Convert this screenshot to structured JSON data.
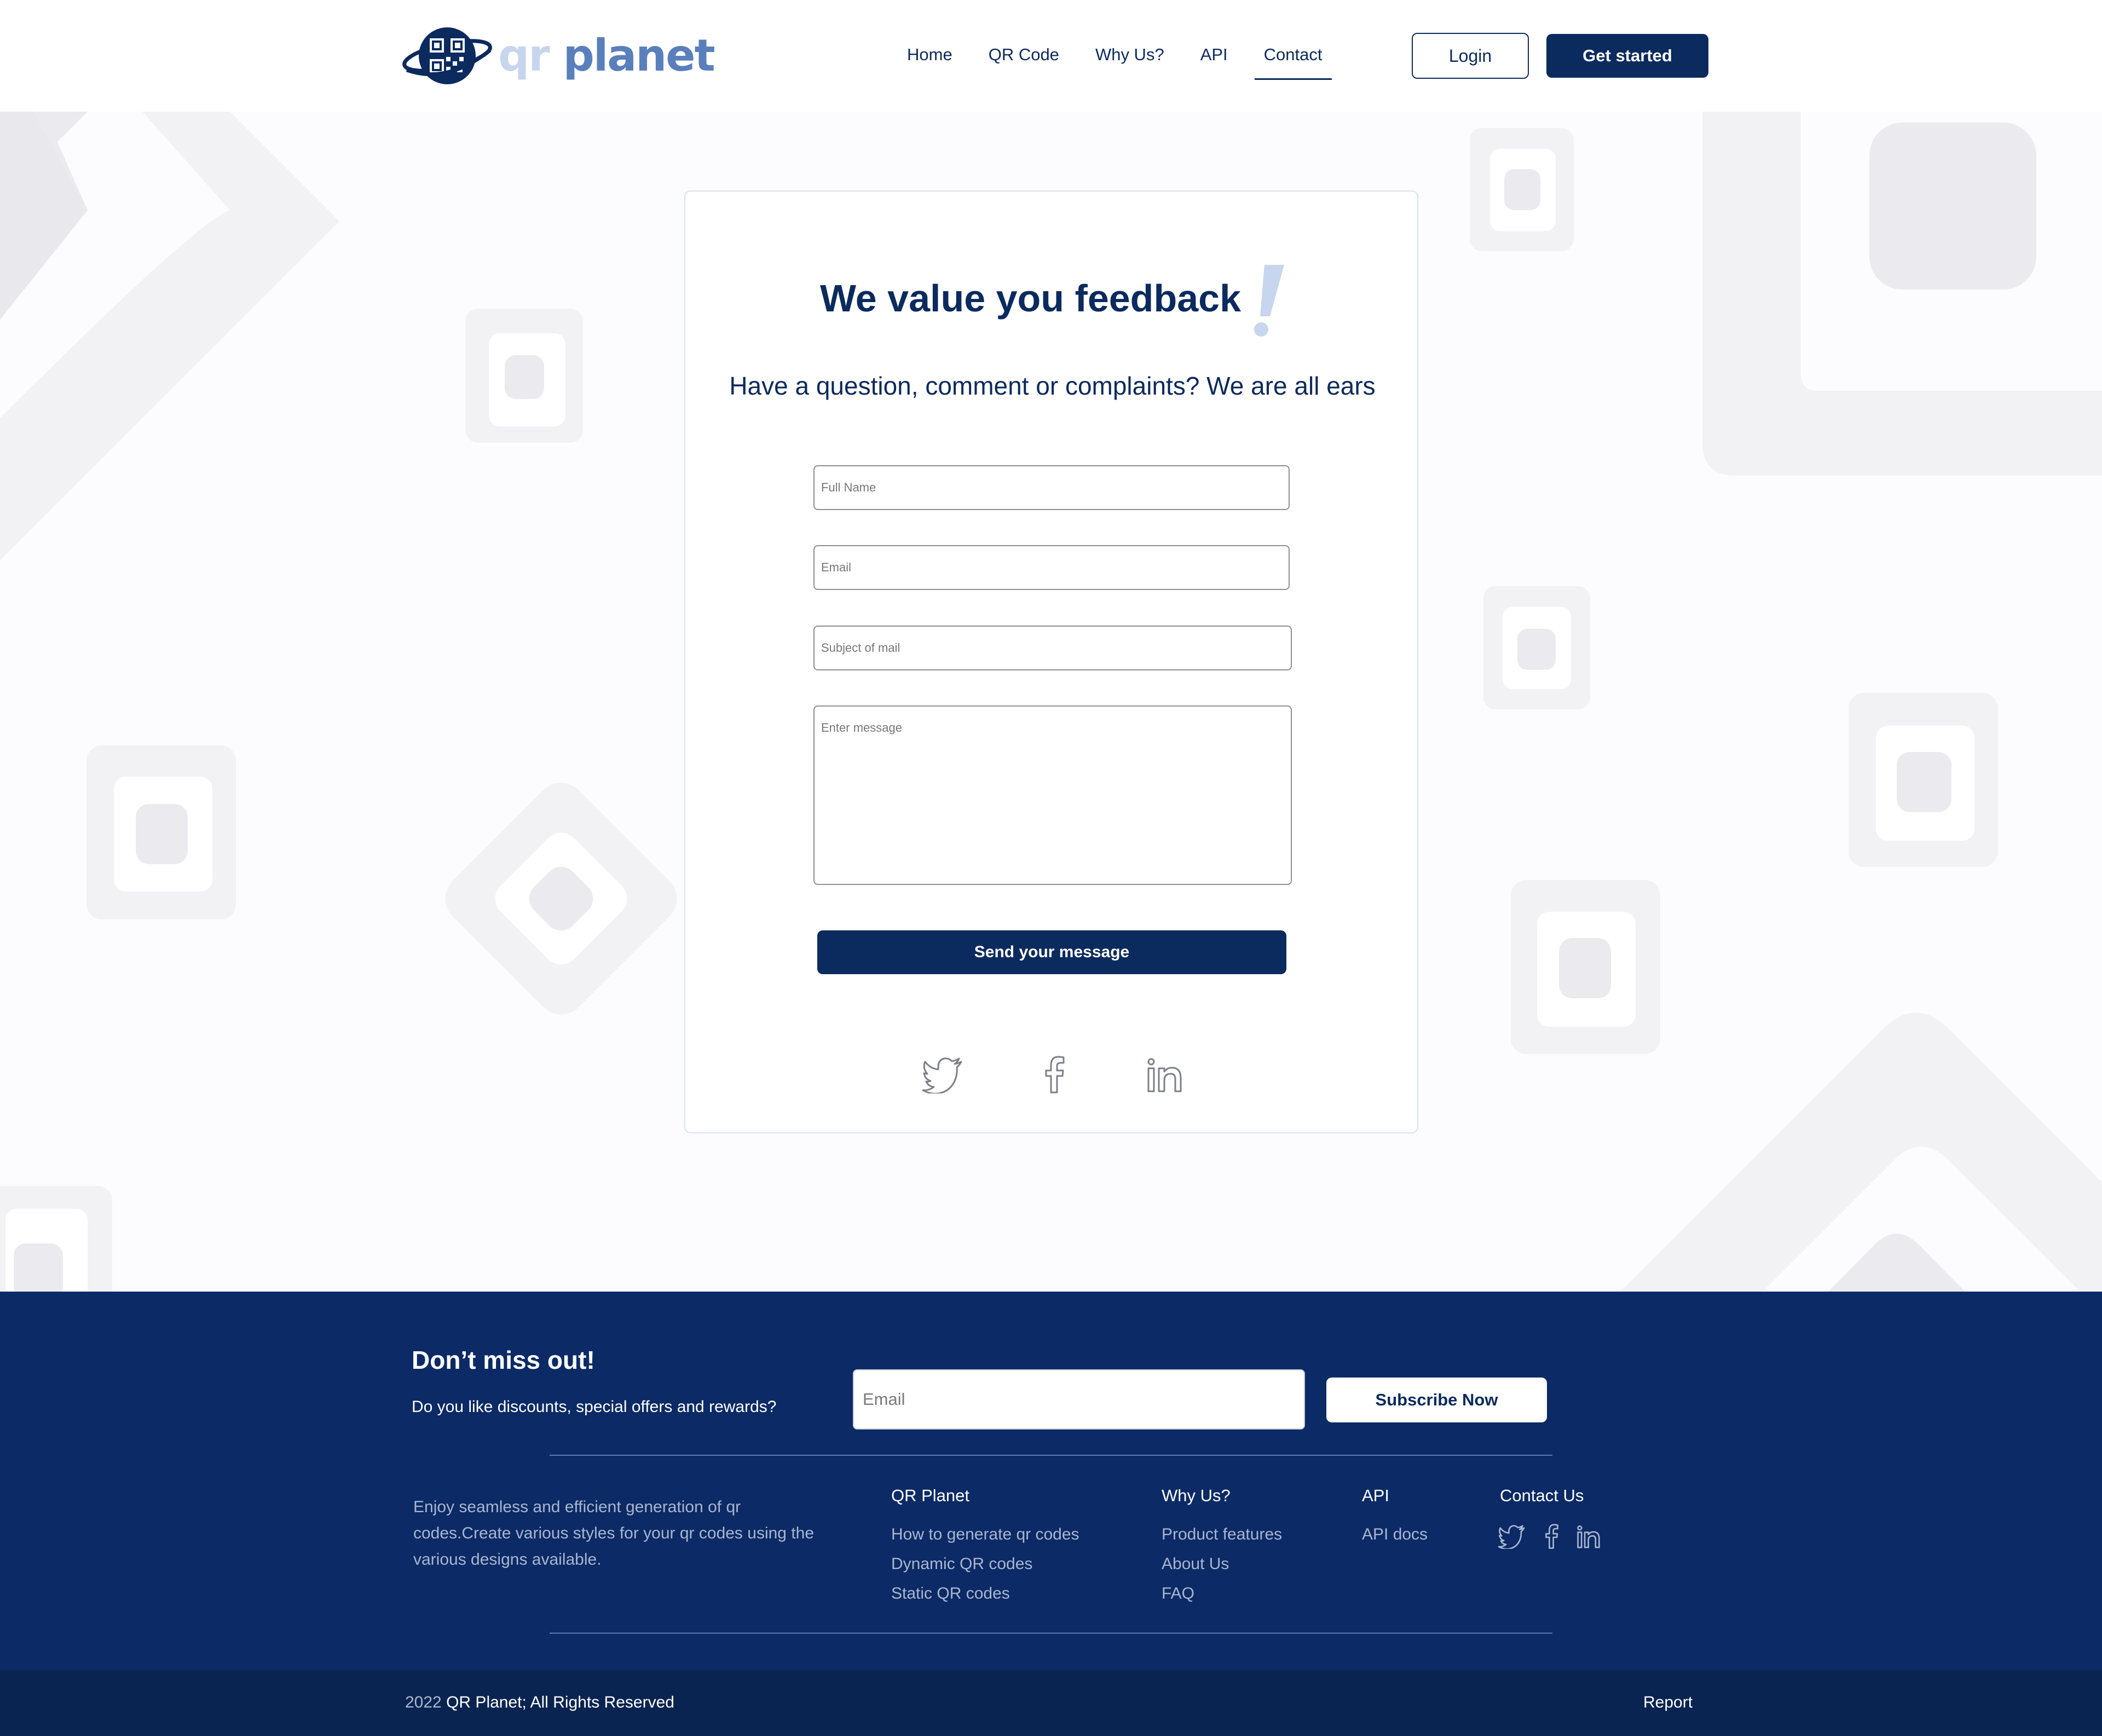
{
  "brand": {
    "logo_qr": "qr",
    "logo_planet": "planet",
    "primary_color": "#0b2a5e",
    "accent_light": "#c7d5ee",
    "accent_mid": "#5a7fbd"
  },
  "nav": {
    "links": [
      {
        "label": "Home",
        "active": false
      },
      {
        "label": "QR Code",
        "active": false
      },
      {
        "label": "Why Us?",
        "active": false
      },
      {
        "label": "API",
        "active": false
      },
      {
        "label": "Contact",
        "active": true
      }
    ],
    "login_label": "Login",
    "get_started_label": "Get started"
  },
  "contact_form": {
    "title": "We value you feedback",
    "title_exclaim": "!",
    "subtitle": "Have a question, comment or complaints? We are all ears",
    "full_name_placeholder": "Full Name",
    "email_placeholder": "Email",
    "subject_placeholder": "Subject of mail",
    "message_placeholder": "Enter message",
    "submit_label": "Send your message",
    "social_icons": [
      "twitter-icon",
      "facebook-icon",
      "linkedin-icon"
    ]
  },
  "newsletter": {
    "title": "Don’t miss out!",
    "subtitle": "Do you like discounts, special offers and rewards?",
    "email_placeholder": "Email",
    "subscribe_label": "Subscribe Now"
  },
  "footer": {
    "description": "Enjoy seamless and efficient generation of qr codes.Create various styles for your qr codes using the various designs available.",
    "columns": [
      {
        "title": "QR Planet",
        "links": [
          "How to generate qr codes",
          "Dynamic QR codes",
          "Static QR codes"
        ]
      },
      {
        "title": "Why Us?",
        "links": [
          "Product features",
          "About Us",
          "FAQ"
        ]
      },
      {
        "title": "API",
        "links": [
          "API docs"
        ]
      },
      {
        "title": "Contact Us",
        "links": []
      }
    ],
    "social_icons": [
      "twitter-icon",
      "facebook-icon",
      "linkedin-icon"
    ],
    "copyright_year": "2022",
    "copyright_text": "QR Planet;  All Rights Reserved",
    "report_label": "Report"
  },
  "colors": {
    "footer_bg": "#0b2a66",
    "bottom_bar_bg": "#0a2451",
    "page_bg": "#fcfbfd"
  }
}
